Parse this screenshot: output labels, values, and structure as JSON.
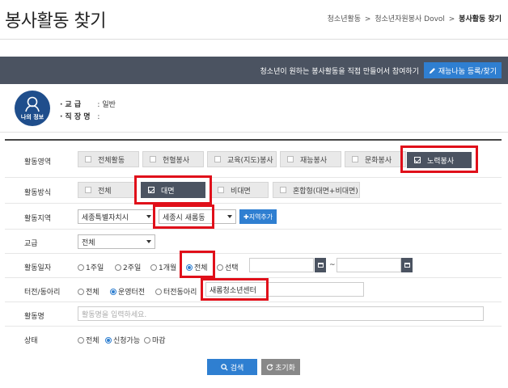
{
  "header": {
    "title": "봉사활동 찾기",
    "breadcrumb": [
      "청소년활동",
      "청소년자원봉사 Dovol",
      "봉사활동 찾기"
    ]
  },
  "banner": {
    "text": "청소년이 원하는 봉사활동을 직접 만들어서 참여하기",
    "button_label": "재능나눔 등록/찾기",
    "button_icon": "pencil-icon"
  },
  "my_info": {
    "avatar_label": "나의 정보",
    "rows": [
      {
        "key": "교     급",
        "value": ": 일반"
      },
      {
        "key": "직 장 명",
        "value": ":"
      }
    ]
  },
  "form": {
    "activity_area": {
      "label": "활동영역",
      "options": [
        {
          "label": "전체활동",
          "checked": false
        },
        {
          "label": "헌혈봉사",
          "checked": false
        },
        {
          "label": "교육(지도)봉사",
          "checked": false
        },
        {
          "label": "재능봉사",
          "checked": false
        },
        {
          "label": "문화봉사",
          "checked": false
        },
        {
          "label": "노력봉사",
          "checked": true
        }
      ]
    },
    "activity_method": {
      "label": "활동방식",
      "options": [
        {
          "label": "전체",
          "checked": false
        },
        {
          "label": "대면",
          "checked": true
        },
        {
          "label": "비대면",
          "checked": false
        },
        {
          "label": "혼합형(대면+비대면)",
          "checked": false
        }
      ]
    },
    "activity_region": {
      "label": "활동지역",
      "province": "세종특별자치시",
      "district": "세종시 새롬동",
      "add_label": "✚지역추가"
    },
    "school_level": {
      "label": "교급",
      "value": "전체"
    },
    "activity_date": {
      "label": "활동일자",
      "options": [
        {
          "label": "1주일",
          "checked": false
        },
        {
          "label": "2주일",
          "checked": false
        },
        {
          "label": "1개월",
          "checked": false
        },
        {
          "label": "전체",
          "checked": true
        },
        {
          "label": "선택",
          "checked": false
        }
      ],
      "start": "",
      "end": "",
      "separator": "~"
    },
    "center": {
      "label": "터전/동아리",
      "options": [
        {
          "label": "전체",
          "checked": false
        },
        {
          "label": "운영터전",
          "checked": true
        },
        {
          "label": "터전동아리",
          "checked": false
        }
      ],
      "value": "새롬청소년센터"
    },
    "activity_name": {
      "label": "활동명",
      "placeholder": "활동명을 입력하세요."
    },
    "status": {
      "label": "상태",
      "options": [
        {
          "label": "전체",
          "checked": false
        },
        {
          "label": "신청가능",
          "checked": true
        },
        {
          "label": "마감",
          "checked": false
        }
      ]
    }
  },
  "actions": {
    "search_label": "검색",
    "reset_label": "초기화"
  },
  "colors": {
    "primary": "#2f7fd1",
    "dark": "#4b5361",
    "highlight": "#e0101a"
  }
}
